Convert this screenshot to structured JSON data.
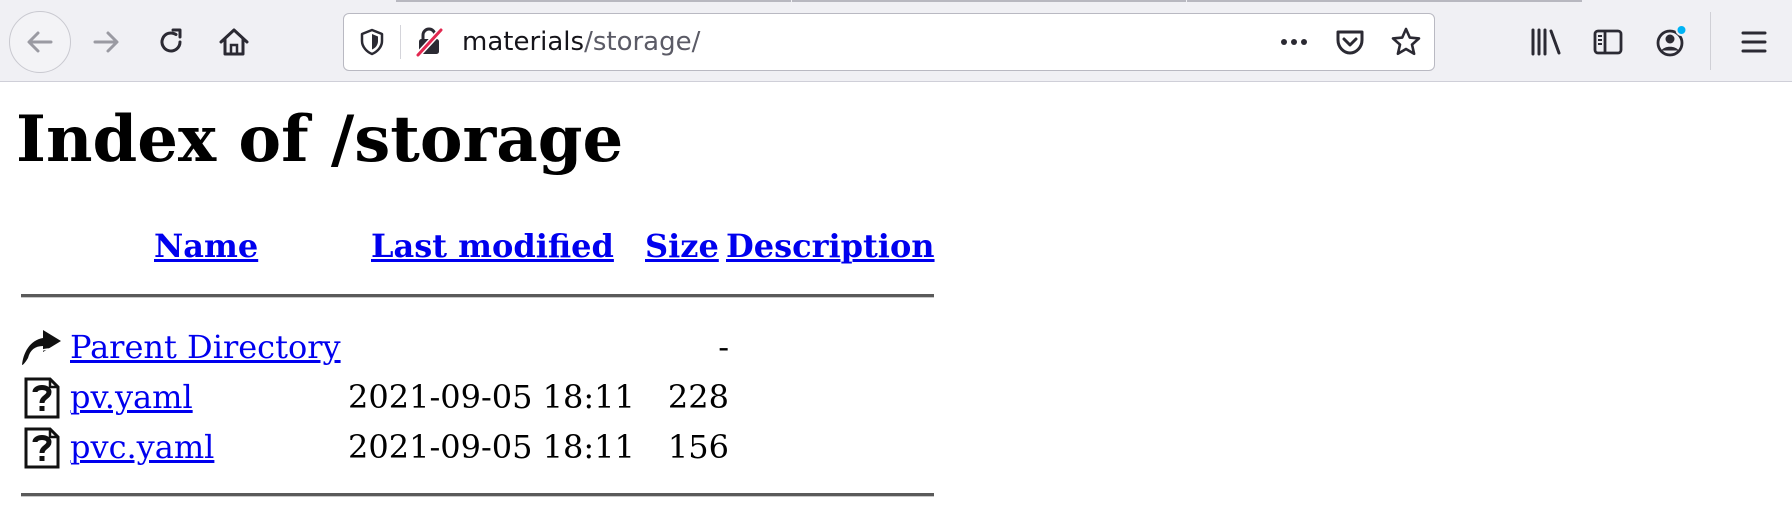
{
  "browser": {
    "url": {
      "host": "materials",
      "path": "/storage/"
    },
    "icons": {
      "back": "back-arrow-icon",
      "forward": "forward-arrow-icon",
      "reload": "reload-icon",
      "home": "home-icon",
      "tracking_protection": "shield-icon",
      "insecure_connection": "insecure-lock-icon",
      "page_actions": "more-horizontal-icon",
      "pocket": "pocket-icon",
      "bookmark": "star-icon",
      "library": "library-icon",
      "sidebar": "sidebar-icon",
      "account": "account-icon",
      "menu": "hamburger-menu-icon"
    },
    "colors": {
      "toolbar_bg": "#f0f0f4",
      "account_badge": "#00b3f4",
      "insecure_slash": "#e22850"
    }
  },
  "page": {
    "title": "Index of /storage",
    "columns": {
      "name": "Name",
      "last_modified": "Last modified",
      "size": "Size",
      "description": "Description"
    },
    "rows": [
      {
        "icon": "parent-directory-icon",
        "name": "Parent Directory",
        "last_modified": "",
        "size": "-",
        "description": ""
      },
      {
        "icon": "unknown-file-icon",
        "name": "pv.yaml",
        "last_modified": "2021-09-05 18:11",
        "size": "228",
        "description": ""
      },
      {
        "icon": "unknown-file-icon",
        "name": "pvc.yaml",
        "last_modified": "2021-09-05 18:11",
        "size": "156",
        "description": ""
      }
    ],
    "colors": {
      "link": "#0000ee",
      "text": "#000000"
    }
  }
}
